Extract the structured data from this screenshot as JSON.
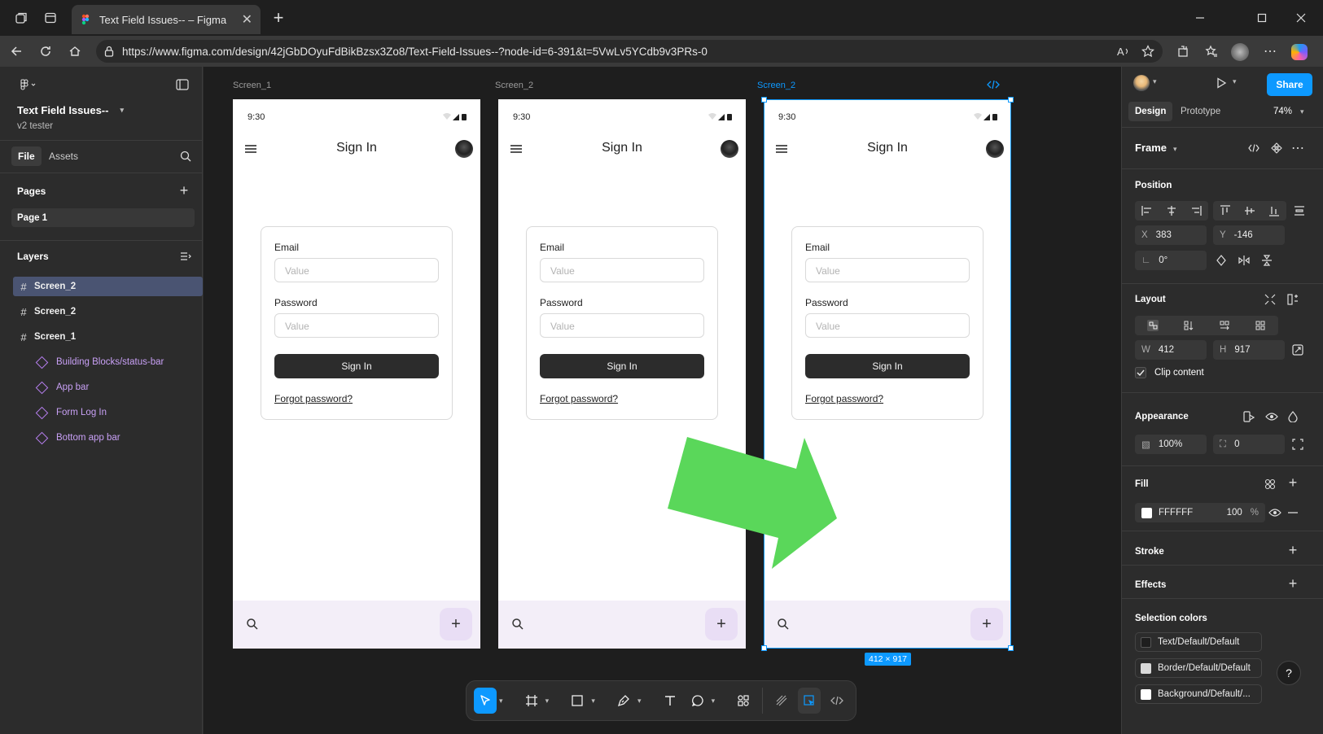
{
  "browser": {
    "tab_title": "Text Field Issues-- – Figma",
    "url": "https://www.figma.com/design/42jGbDOyuFdBikBzsx3Zo8/Text-Field-Issues--?node-id=6-391&t=5VwLv5YCdb9v3PRs-0",
    "close_glyph": "✕",
    "new_tab_glyph": "+"
  },
  "left_panel": {
    "file_name": "Text Field Issues--",
    "team": "v2 tester",
    "tabs": [
      "File",
      "Assets"
    ],
    "pages_title": "Pages",
    "pages": [
      "Page 1"
    ],
    "layers_title": "Layers",
    "layers": [
      {
        "name": "Screen_2",
        "selected": true
      },
      {
        "name": "Screen_2",
        "selected": false
      },
      {
        "name": "Screen_1",
        "selected": false
      }
    ],
    "sublayers": [
      "Building Blocks/status-bar",
      "App bar",
      "Form Log In",
      "Bottom app bar"
    ]
  },
  "canvas": {
    "frames": [
      {
        "label": "Screen_1"
      },
      {
        "label": "Screen_2"
      },
      {
        "label": "Screen_2"
      }
    ],
    "phone": {
      "time": "9:30",
      "title": "Sign In",
      "email_label": "Email",
      "email_placeholder": "Value",
      "password_label": "Password",
      "password_placeholder": "Value",
      "signin_button": "Sign In",
      "forgot": "Forgot password?",
      "fab": "+"
    },
    "size_tag": "412 × 917",
    "arrow_color": "#5ad75a"
  },
  "right_panel": {
    "tabs": [
      "Design",
      "Prototype"
    ],
    "zoom": "74%",
    "share": "Share",
    "frame_title": "Frame",
    "position_title": "Position",
    "x": {
      "k": "X",
      "v": "383"
    },
    "y": {
      "k": "Y",
      "v": "-146"
    },
    "rotation": "0°",
    "layout_title": "Layout",
    "w": {
      "k": "W",
      "v": "412"
    },
    "h": {
      "k": "H",
      "v": "917"
    },
    "clip": "Clip content",
    "appearance_title": "Appearance",
    "opacity": "100%",
    "radius": "0",
    "fill_title": "Fill",
    "fill_hex": "FFFFFF",
    "fill_opacity": "100",
    "fill_pct": "%",
    "stroke_title": "Stroke",
    "effects_title": "Effects",
    "selection_colors_title": "Selection colors",
    "selection_colors": [
      {
        "name": "Text/Default/Default",
        "color": "#1e1e1e"
      },
      {
        "name": "Border/Default/Default",
        "color": "#d9d9d9"
      },
      {
        "name": "Background/Default/...",
        "color": "#ffffff"
      }
    ],
    "help": "?"
  },
  "colors": {
    "accent": "#0d99ff",
    "layer_selected": "#4a5472",
    "component": "#c8a0f5"
  }
}
